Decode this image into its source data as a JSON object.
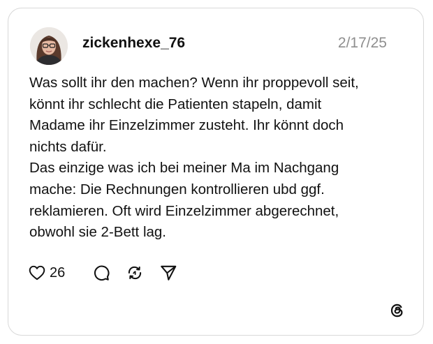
{
  "post": {
    "username": "zickenhexe_76",
    "date": "2/17/25",
    "text": "Was sollt ihr den machen? Wenn ihr proppevoll seit,\nkönnt ihr schlecht die Patienten stapeln, damit\nMadame ihr Einzelzimmer zusteht. Ihr könnt doch\nnichts dafür.\nDas einzige was ich bei meiner Ma im Nachgang\nmache: Die Rechnungen kontrollieren ubd ggf.\nreklamieren. Oft wird Einzelzimmer  abgerechnet,\nobwohl sie 2-Bett lag."
  },
  "actions": {
    "like_icon": "heart-icon",
    "like_count": "26",
    "reply_icon": "comment-bubble-icon",
    "repost_icon": "repost-icon",
    "share_icon": "send-icon"
  },
  "branding": {
    "logo_icon": "threads-logo-icon"
  },
  "colors": {
    "text": "#111111",
    "muted": "#8e8e8e",
    "border": "#d8d8d8",
    "background": "#ffffff"
  }
}
